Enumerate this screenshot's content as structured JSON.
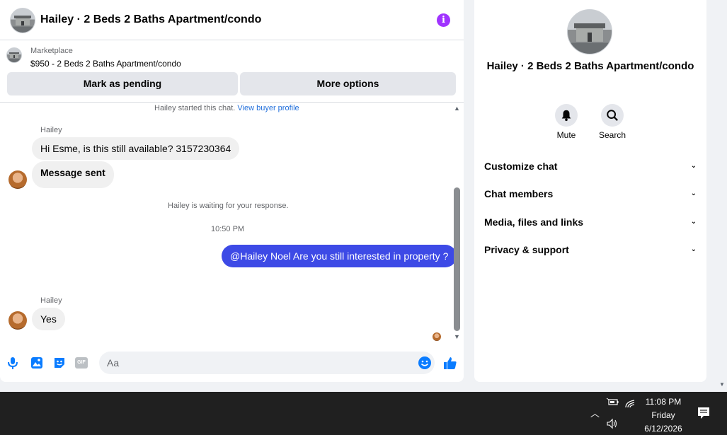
{
  "header": {
    "title": "Hailey · 2 Beds 2 Baths Apartment/condo",
    "info_icon": "info-icon"
  },
  "marketplace": {
    "label": "Marketplace",
    "listing": "$950 - 2 Beds 2 Baths Apartment/condo",
    "mark_pending_label": "Mark as pending",
    "more_options_label": "More options"
  },
  "messages": {
    "started_text": "Hailey started this chat.",
    "view_profile_link": "View buyer profile",
    "sender_1": "Hailey",
    "msg_1": "Hi Esme, is this still available? 3157230364",
    "msg_2": "Message sent",
    "waiting_text": "Hailey is waiting for your response.",
    "timestamp": "10:50 PM",
    "outgoing_1": "@Hailey Noel Are you still interested in property ?",
    "sender_2": "Hailey",
    "msg_3": "Yes"
  },
  "composer": {
    "placeholder": "Aa",
    "icons": [
      "microphone-icon",
      "image-icon",
      "sticker-icon",
      "gif-icon",
      "emoji-icon",
      "like-icon"
    ],
    "gif_text": "GIF"
  },
  "side_panel": {
    "name": "Hailey · 2 Beds 2 Baths Apartment/condo",
    "mute_label": "Mute",
    "search_label": "Search",
    "sections": [
      "Customize chat",
      "Chat members",
      "Media, files and links",
      "Privacy & support"
    ]
  },
  "taskbar": {
    "time": "11:08 PM",
    "day": "Friday",
    "date": "6/12/2026"
  },
  "colors": {
    "accent": "#3d4ae6",
    "info": "#a033ff",
    "messenger_blue": "#0a7cff"
  }
}
